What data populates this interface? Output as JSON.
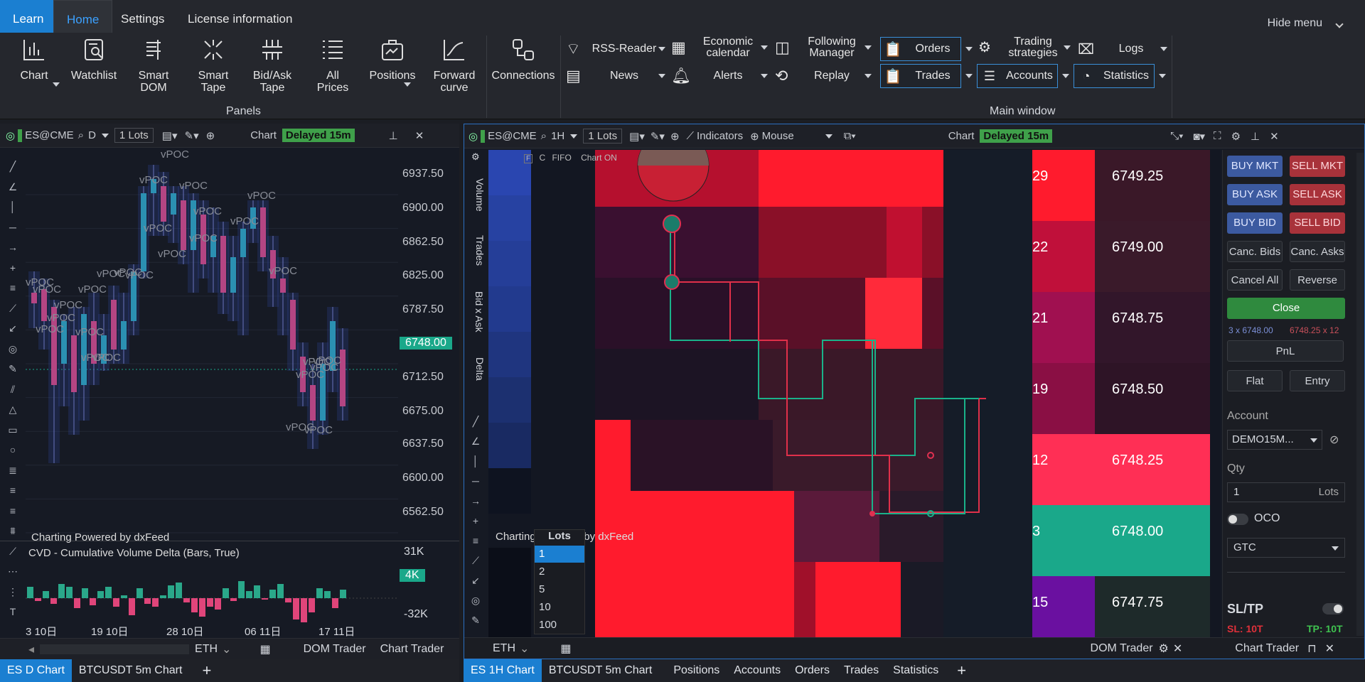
{
  "ribbon": {
    "tabs": [
      "Learn",
      "Home",
      "Settings",
      "License information"
    ],
    "hide_menu": "Hide menu",
    "panel_buttons": [
      {
        "label": "Chart",
        "icon": "bar-chart-icon"
      },
      {
        "label": "Watchlist",
        "icon": "watchlist-icon"
      },
      {
        "label": "Smart DOM",
        "icon": "smart-dom-icon"
      },
      {
        "label": "Smart Tape",
        "icon": "smart-tape-icon"
      },
      {
        "label": "Bid/Ask Tape",
        "icon": "bid-ask-tape-icon"
      },
      {
        "label": "All Prices",
        "icon": "all-prices-icon"
      },
      {
        "label": "Positions",
        "icon": "briefcase-icon"
      },
      {
        "label": "Forward curve",
        "icon": "forward-curve-icon"
      },
      {
        "label": "Connections",
        "icon": "connections-icon"
      }
    ],
    "panels_group": "Panels",
    "main_window_group": "Main window",
    "main_items": [
      {
        "label": "RSS-Reader",
        "icon": "rss-icon"
      },
      {
        "label": "Economic calendar",
        "icon": "calendar-dollar-icon"
      },
      {
        "label": "Following Manager",
        "icon": "following-manager-icon"
      },
      {
        "label": "News",
        "icon": "news-icon"
      },
      {
        "label": "Alerts",
        "icon": "bell-icon"
      },
      {
        "label": "Replay",
        "icon": "replay-icon"
      },
      {
        "label": "Orders",
        "icon": "orders-icon"
      },
      {
        "label": "Trading strategies",
        "icon": "strategies-icon"
      },
      {
        "label": "Logs",
        "icon": "logs-icon"
      },
      {
        "label": "Trades",
        "icon": "trades-icon"
      },
      {
        "label": "Accounts",
        "icon": "accounts-icon"
      },
      {
        "label": "Statistics",
        "icon": "pie-chart-icon"
      }
    ]
  },
  "left_chart": {
    "symbol": "ES@CME",
    "timeframe": "D",
    "lots_value": "1",
    "lots_label": "Lots",
    "chart_label": "Chart",
    "delayed": "Delayed 15m",
    "y_ticks": [
      "6937.50",
      "6900.00",
      "6862.50",
      "6825.00",
      "6787.50",
      "6748.00",
      "6712.50",
      "6675.00",
      "6637.50",
      "6600.00",
      "6562.50"
    ],
    "current_price": "6748.00",
    "vpoc": "vPOC",
    "powered": "Charting Powered by dxFeed",
    "cvd_title": "CVD - Cumulative Volume Delta (Bars, True)",
    "cvd_ticks": [
      "31K",
      "4K",
      "-32K"
    ],
    "x_ticks": [
      "3 10日",
      "19 10日",
      "28 10日",
      "06 11日",
      "17 11日"
    ],
    "session": "ETH",
    "dom_trader": "DOM Trader",
    "chart_trader": "Chart Trader",
    "tabs": [
      "ES D Chart",
      "BTCUSDT 5m Chart"
    ]
  },
  "right_chart": {
    "symbol": "ES@CME",
    "timeframe": "1H",
    "lots_value": "1",
    "lots_label": "Lots",
    "indicators": "Indicators",
    "mouse": "Mouse",
    "chart_label": "Chart",
    "delayed": "Delayed 15m",
    "flags": [
      "C",
      "FIFO",
      "Chart ON"
    ],
    "side_labels": [
      "Volume",
      "Trades",
      "Bid x Ask",
      "Delta"
    ],
    "powered": "Charting Powered by dxFeed",
    "lots_popup": {
      "title": "Lots",
      "options": [
        "1",
        "2",
        "5",
        "10",
        "100"
      ]
    },
    "dom": [
      {
        "count": "29",
        "price": "6749.25"
      },
      {
        "count": "22",
        "price": "6749.00"
      },
      {
        "count": "21",
        "price": "6748.75"
      },
      {
        "count": "19",
        "price": "6748.50"
      },
      {
        "count": "12",
        "price": "6748.25"
      },
      {
        "count": "3",
        "price": "6748.00"
      },
      {
        "count": "15",
        "price": "6747.75"
      }
    ],
    "session": "ETH",
    "dom_trader": "DOM Trader",
    "chart_trader": "Chart Trader",
    "tabs": [
      "ES 1H Chart",
      "BTCUSDT 5m Chart",
      "Positions",
      "Accounts",
      "Orders",
      "Trades",
      "Statistics"
    ]
  },
  "trader": {
    "buy_mkt": "BUY MKT",
    "sell_mkt": "SELL MKT",
    "buy_ask": "BUY ASK",
    "sell_ask": "SELL ASK",
    "buy_bid": "BUY BID",
    "sell_bid": "SELL BID",
    "canc_bids": "Canc. Bids",
    "canc_asks": "Canc. Asks",
    "cancel_all": "Cancel All",
    "reverse": "Reverse",
    "close": "Close",
    "pos_buy": "3 x 6748.00",
    "pos_sell": "6748.25 x 12",
    "pnl": "PnL",
    "flat": "Flat",
    "entry": "Entry",
    "account_label": "Account",
    "account_value": "DEMO15M...",
    "qty_label": "Qty",
    "qty_value": "1",
    "qty_unit": "Lots",
    "oco": "OCO",
    "tif": "GTC",
    "sltp": "SL/TP",
    "sl": "SL: 10T",
    "tp": "TP: 10T"
  },
  "colors": {
    "accent": "#1b7fd1",
    "delayed": "#3fa04a",
    "bull": "#2aa9b8",
    "bear": "#e0457a",
    "teal": "#1aa88a",
    "red": "#ff1b2d"
  }
}
